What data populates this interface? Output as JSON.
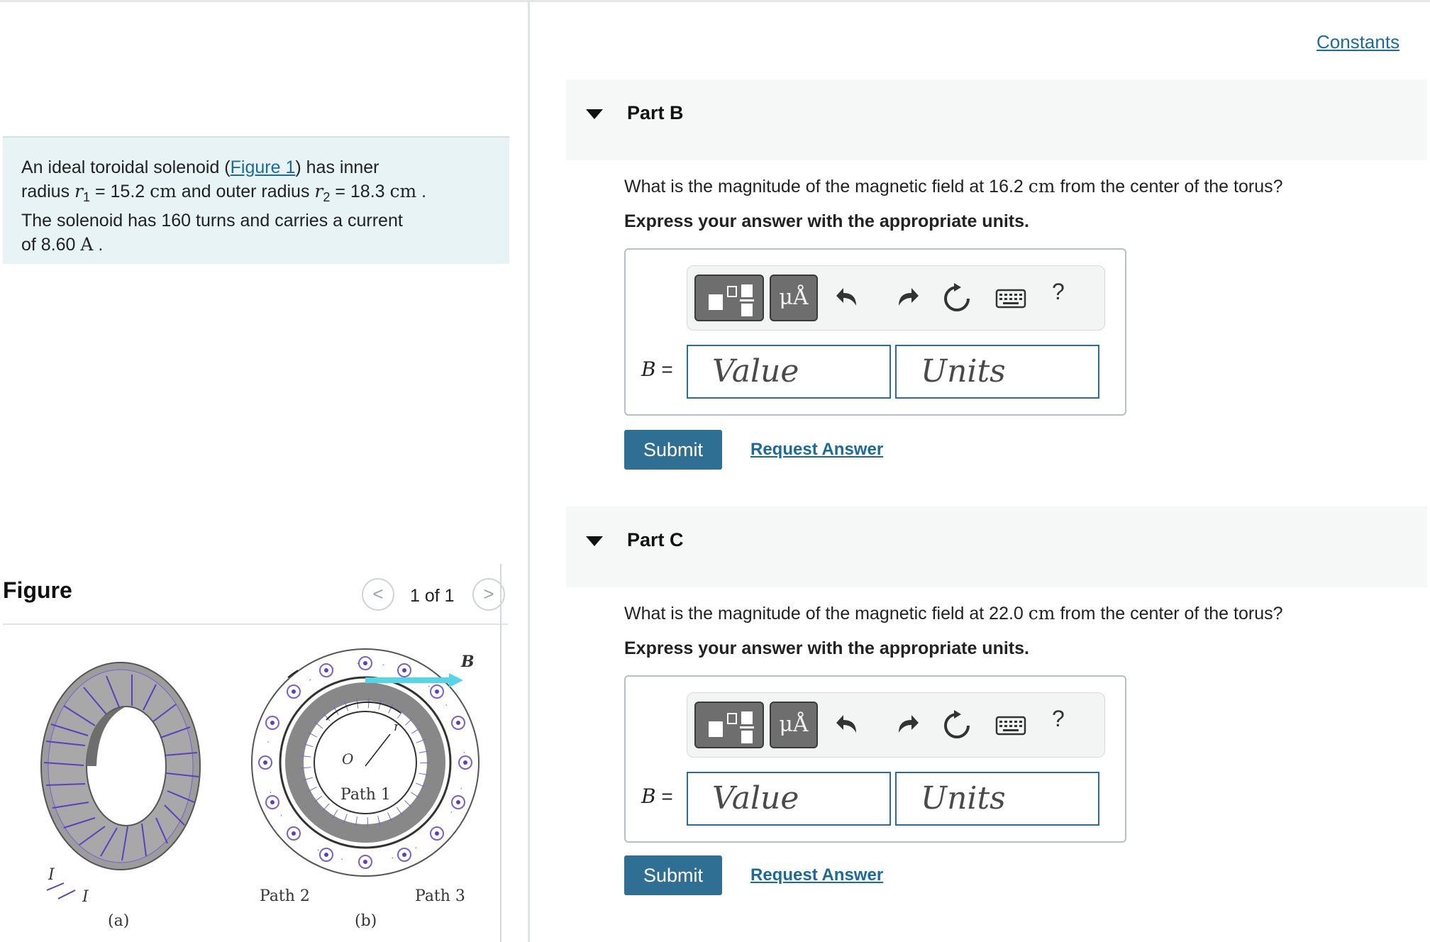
{
  "problem": {
    "t1": "An ideal toroidal solenoid (",
    "figure_link": "Figure 1",
    "t2": ") has inner",
    "t3": "radius ",
    "r1_sym": "r",
    "r1_sub": "1",
    "t4": " = 15.2 ",
    "unit_cm": "cm",
    "t5": " and outer radius ",
    "r2_sym": "r",
    "r2_sub": "2",
    "t6": " = 18.3 ",
    "t7": " .",
    "t8": "The solenoid has 160 turns and carries a current",
    "t9": "of 8.60 ",
    "unit_a": "A",
    "t10": " ."
  },
  "figure": {
    "title": "Figure",
    "prev_icon": "<",
    "next_icon": ">",
    "counter": "1 of 1",
    "labels": {
      "a": "(a)",
      "b": "(b)",
      "path1": "Path 1",
      "path2": "Path 2",
      "path3": "Path 3",
      "r": "r",
      "o": "O",
      "i1": "I",
      "i2": "I",
      "b_vec": "B"
    }
  },
  "constants_link": "Constants",
  "parts": [
    {
      "title": "Part B",
      "q_before": "What is the magnitude of the magnetic field at 16.2 ",
      "q_unit": "cm",
      "q_after": " from the center of the torus?",
      "instruction": "Express your answer with the appropriate units.",
      "label": "B",
      "eq": " =",
      "value_placeholder": "Value",
      "units_placeholder": "Units",
      "mu_label": "μÅ",
      "help_label": "?",
      "submit": "Submit",
      "request": "Request Answer"
    },
    {
      "title": "Part C",
      "q_before": "What is the magnitude of the magnetic field at 22.0 ",
      "q_unit": "cm",
      "q_after": " from the center of the torus?",
      "instruction": "Express your answer with the appropriate units.",
      "label": "B",
      "eq": " =",
      "value_placeholder": "Value",
      "units_placeholder": "Units",
      "mu_label": "μÅ",
      "help_label": "?",
      "submit": "Submit",
      "request": "Request Answer"
    }
  ]
}
